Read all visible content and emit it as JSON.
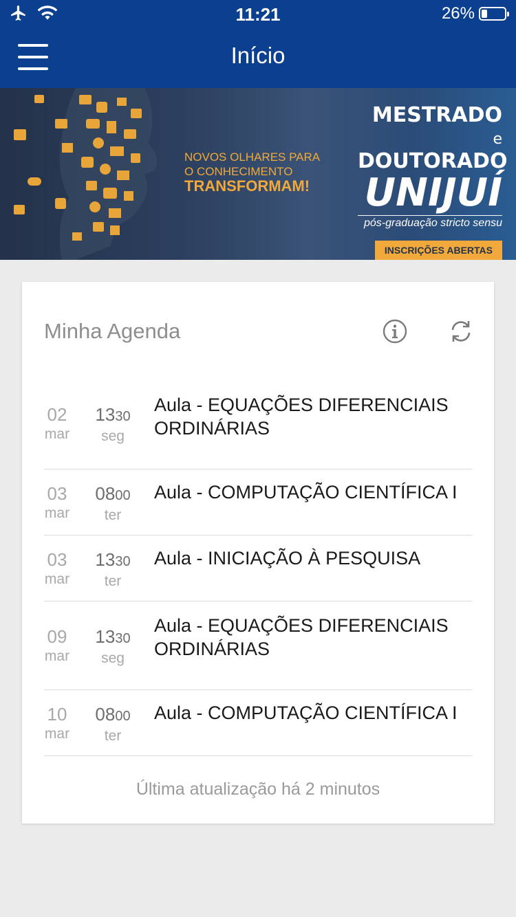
{
  "status_bar": {
    "time": "11:21",
    "battery": "26%",
    "battery_level": 0.26,
    "icons": [
      "airplane-icon",
      "wifi-icon",
      "battery-icon"
    ]
  },
  "nav": {
    "title": "Início",
    "menu_icon": "hamburger-menu-icon"
  },
  "banner": {
    "tagline_line1": "NOVOS OLHARES PARA",
    "tagline_line2": "O CONHECIMENTO",
    "tagline_strong": "TRANSFORMAM!",
    "heading_line1": "MESTRADO",
    "heading_line1_suffix": "e",
    "heading_line2": "DOUTORADO",
    "brand": "UNIJUÍ",
    "subtitle": "pós-graduação stricto sensu",
    "cta": "INSCRIÇÕES ABERTAS",
    "colors": {
      "accent": "#f0a93a",
      "background": "#2c3f5e"
    }
  },
  "agenda": {
    "title": "Minha Agenda",
    "info_icon": "info-icon",
    "refresh_icon": "refresh-icon",
    "items": [
      {
        "day": "02",
        "month": "mar",
        "hour": "13",
        "minute": "30",
        "weekday": "seg",
        "title": "Aula - EQUAÇÕES DIFERENCIAIS ORDINÁRIAS"
      },
      {
        "day": "03",
        "month": "mar",
        "hour": "08",
        "minute": "00",
        "weekday": "ter",
        "title": "Aula - COMPUTAÇÃO CIENTÍFICA I"
      },
      {
        "day": "03",
        "month": "mar",
        "hour": "13",
        "minute": "30",
        "weekday": "ter",
        "title": "Aula - INICIAÇÃO À PESQUISA"
      },
      {
        "day": "09",
        "month": "mar",
        "hour": "13",
        "minute": "30",
        "weekday": "seg",
        "title": "Aula - EQUAÇÕES DIFERENCIAIS ORDINÁRIAS"
      },
      {
        "day": "10",
        "month": "mar",
        "hour": "08",
        "minute": "00",
        "weekday": "ter",
        "title": "Aula - COMPUTAÇÃO CIENTÍFICA I"
      }
    ],
    "last_update": "Última atualização há 2 minutos"
  },
  "colors": {
    "primary": "#0b3f8f",
    "background": "#ebebeb"
  }
}
